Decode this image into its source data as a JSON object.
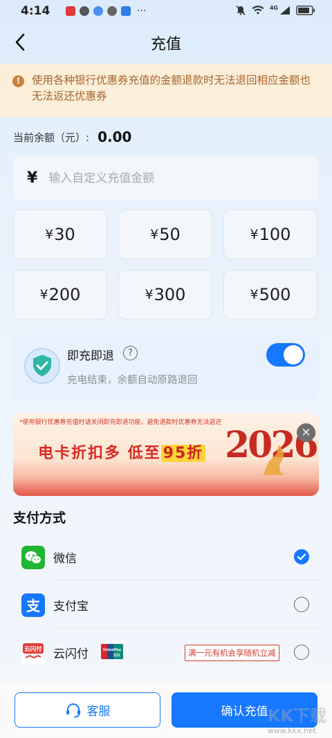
{
  "status_bar": {
    "time": "4:14",
    "network": "4G"
  },
  "header": {
    "title": "充值"
  },
  "notice": {
    "text": "使用各种银行优惠券充值的金额退款时无法退回相应金额也无法返还优惠券"
  },
  "balance": {
    "label": "当前余额（元）:",
    "value": "0.00"
  },
  "amount_input": {
    "symbol": "¥",
    "placeholder": "输入自定义充值金额"
  },
  "presets": [
    {
      "symbol": "¥",
      "amount": "30"
    },
    {
      "symbol": "¥",
      "amount": "50"
    },
    {
      "symbol": "¥",
      "amount": "100"
    },
    {
      "symbol": "¥",
      "amount": "200"
    },
    {
      "symbol": "¥",
      "amount": "300"
    },
    {
      "symbol": "¥",
      "amount": "500"
    }
  ],
  "instant_refund": {
    "title": "即充即退",
    "help": "?",
    "description": "充电结束，余额自动原路退回",
    "enabled": true
  },
  "banner": {
    "note": "*使用银行优惠券充值时请关闭即充即退功能，避免退款时优惠券无法返还",
    "slogan": "电卡折扣多 低至",
    "highlight": "95折",
    "year": "2026",
    "close": "×"
  },
  "payment": {
    "title": "支付方式",
    "methods": [
      {
        "label": "微信",
        "icon": "wechat-pay-icon",
        "selected": true
      },
      {
        "label": "支付宝",
        "icon": "alipay-icon",
        "selected": false
      },
      {
        "label": "云闪付",
        "icon": "unionpay-quickpass-icon",
        "selected": false,
        "badge_icon": "UnionPay",
        "promo": "满一元有机会享随机立减"
      }
    ]
  },
  "actions": {
    "service_label": "客服",
    "confirm_label": "确认充值"
  },
  "watermark": {
    "brand": "KK下载",
    "url": "www.kkx.net"
  },
  "colors": {
    "accent": "#1677ff",
    "notice_bg": "#fbefd9",
    "notice_text": "#a8652e",
    "promo_red": "#d63a2f"
  }
}
